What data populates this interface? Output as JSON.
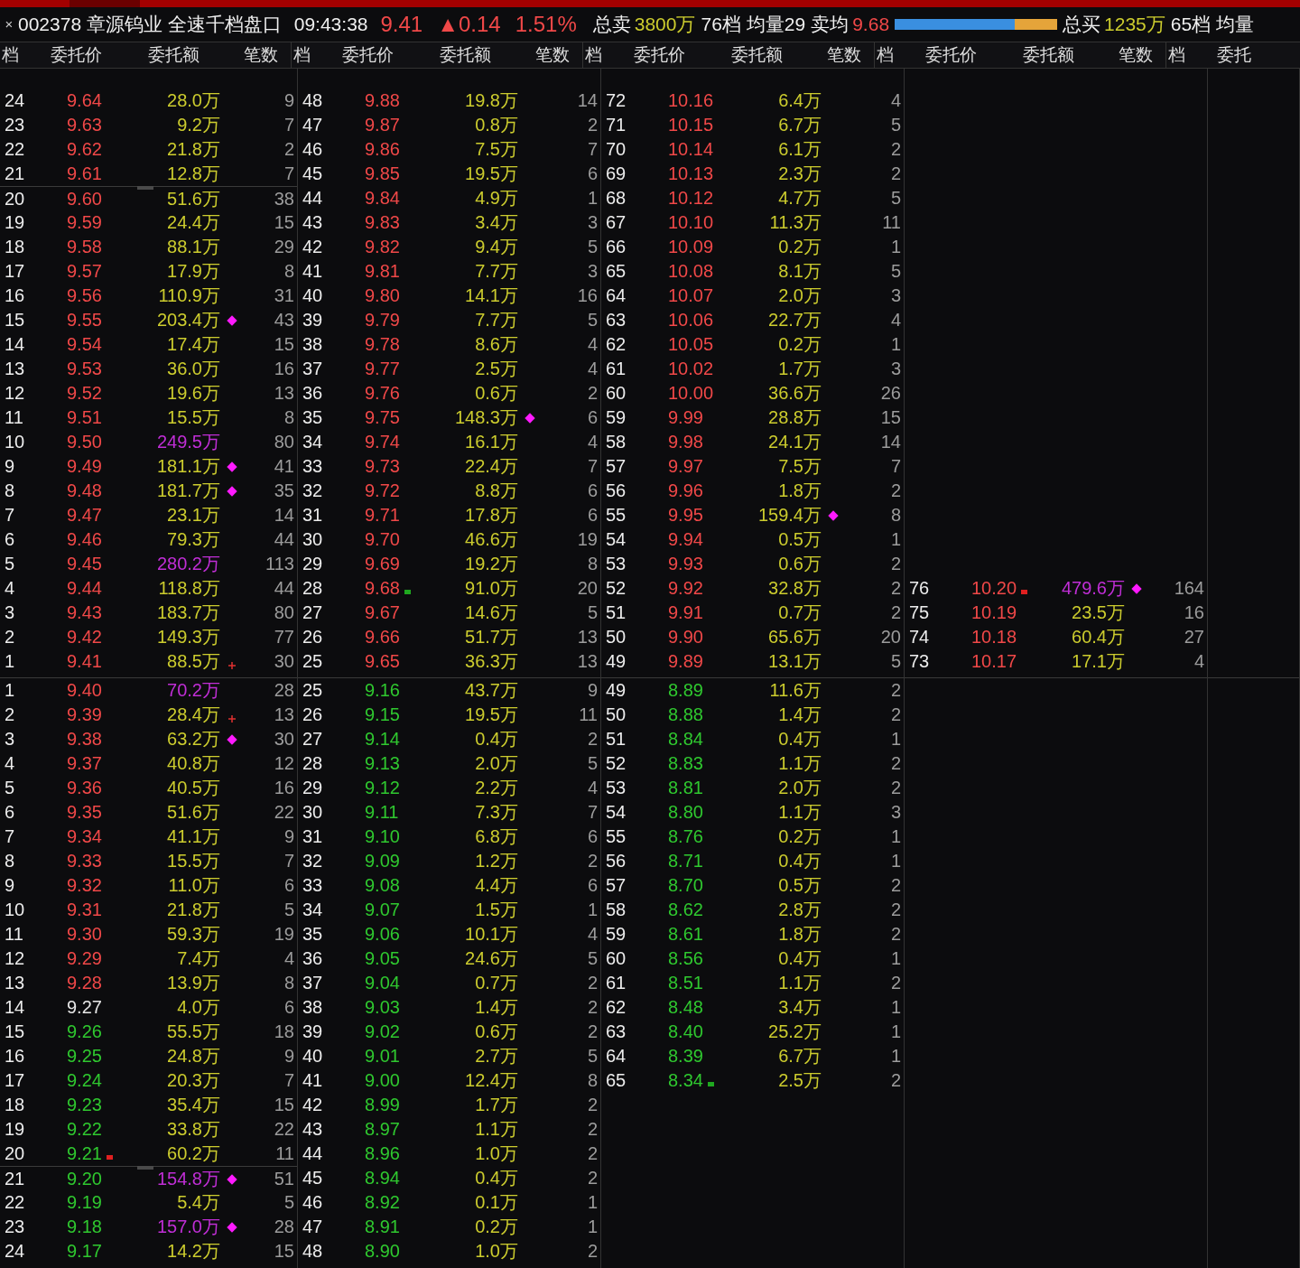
{
  "title": {
    "close": "×",
    "name": "002378 章源钨业 全速千档盘口",
    "time": "09:43:38",
    "price": "9.41",
    "change": "▲0.14",
    "percent": "1.51%",
    "sell_label": "总卖",
    "sell_total": "3800万",
    "sell_levels": "76档",
    "sell_avg_volume": "均量29",
    "sell_avg_label": "卖均",
    "sell_avg_price": "9.68",
    "ratio_bar": {
      "level": 0.74
    },
    "buy_label": "总买",
    "buy_total": "1235万",
    "buy_levels": "65档",
    "buy_avg_volume": "均量"
  },
  "columns": [
    {
      "headers": [
        "档",
        "委托价",
        "委托额",
        "笔数"
      ]
    },
    {
      "headers": [
        "档",
        "委托价",
        "委托额",
        "笔数"
      ]
    },
    {
      "headers": [
        "档",
        "委托价",
        "委托额",
        "笔数"
      ]
    },
    {
      "headers": [
        "档",
        "委托价",
        "委托额",
        "笔数"
      ]
    },
    {
      "headers": [
        "档",
        "委托"
      ]
    }
  ],
  "sell_columns": [
    {
      "rows": [
        {
          "level": "24",
          "price": "9.64",
          "amount": "28.0万",
          "count": "9",
          "color": "#f04848",
          "big": false
        },
        {
          "level": "23",
          "price": "9.63",
          "amount": "9.2万",
          "count": "7",
          "color": "#f04848",
          "big": false
        },
        {
          "level": "22",
          "price": "9.62",
          "amount": "21.8万",
          "count": "2",
          "color": "#f04848",
          "big": false
        },
        {
          "level": "21",
          "price": "9.61",
          "amount": "12.8万",
          "count": "7",
          "color": "#f04848",
          "big": false
        },
        {
          "level": "20",
          "price": "9.60",
          "amount": "51.6万",
          "count": "38",
          "color": "#f04848",
          "big": false,
          "separator": true
        },
        {
          "level": "19",
          "price": "9.59",
          "amount": "24.4万",
          "count": "15",
          "color": "#f04848",
          "big": false
        },
        {
          "level": "18",
          "price": "9.58",
          "amount": "88.1万",
          "count": "29",
          "color": "#f04848",
          "big": false
        },
        {
          "level": "17",
          "price": "9.57",
          "amount": "17.9万",
          "count": "8",
          "color": "#f04848",
          "big": false
        },
        {
          "level": "16",
          "price": "9.56",
          "amount": "110.9万",
          "count": "31",
          "color": "#f04848",
          "big": false
        },
        {
          "level": "15",
          "price": "9.55",
          "amount": "203.4万",
          "count": "43",
          "color": "#f04848",
          "big": false,
          "diamond": true
        },
        {
          "level": "14",
          "price": "9.54",
          "amount": "17.4万",
          "count": "15",
          "color": "#f04848",
          "big": false
        },
        {
          "level": "13",
          "price": "9.53",
          "amount": "36.0万",
          "count": "16",
          "color": "#f04848",
          "big": false
        },
        {
          "level": "12",
          "price": "9.52",
          "amount": "19.6万",
          "count": "13",
          "color": "#f04848",
          "big": false
        },
        {
          "level": "11",
          "price": "9.51",
          "amount": "15.5万",
          "count": "8",
          "color": "#f04848",
          "big": false
        },
        {
          "level": "10",
          "price": "9.50",
          "amount": "249.5万",
          "count": "80",
          "color": "#f04848",
          "big": true
        },
        {
          "level": "9",
          "price": "9.49",
          "amount": "181.1万",
          "count": "41",
          "color": "#f04848",
          "big": false,
          "diamond": true
        },
        {
          "level": "8",
          "price": "9.48",
          "amount": "181.7万",
          "count": "35",
          "color": "#f04848",
          "big": false,
          "diamond": true
        },
        {
          "level": "7",
          "price": "9.47",
          "amount": "23.1万",
          "count": "14",
          "color": "#f04848",
          "big": false
        },
        {
          "level": "6",
          "price": "9.46",
          "amount": "79.3万",
          "count": "44",
          "color": "#f04848",
          "big": false
        },
        {
          "level": "5",
          "price": "9.45",
          "amount": "280.2万",
          "count": "113",
          "color": "#f04848",
          "big": true
        },
        {
          "level": "4",
          "price": "9.44",
          "amount": "118.8万",
          "count": "44",
          "color": "#f04848",
          "big": false
        },
        {
          "level": "3",
          "price": "9.43",
          "amount": "183.7万",
          "count": "80",
          "color": "#f04848",
          "big": false
        },
        {
          "level": "2",
          "price": "9.42",
          "amount": "149.3万",
          "count": "77",
          "color": "#f04848",
          "big": false
        },
        {
          "level": "1",
          "price": "9.41",
          "amount": "88.5万",
          "count": "30",
          "color": "#f04848",
          "big": false,
          "plus": true
        }
      ]
    },
    {
      "rows": [
        {
          "level": "48",
          "price": "9.88",
          "amount": "19.8万",
          "count": "14",
          "color": "#f04848",
          "big": false
        },
        {
          "level": "47",
          "price": "9.87",
          "amount": "0.8万",
          "count": "2",
          "color": "#f04848",
          "big": false
        },
        {
          "level": "46",
          "price": "9.86",
          "amount": "7.5万",
          "count": "7",
          "color": "#f04848",
          "big": false
        },
        {
          "level": "45",
          "price": "9.85",
          "amount": "19.5万",
          "count": "6",
          "color": "#f04848",
          "big": false
        },
        {
          "level": "44",
          "price": "9.84",
          "amount": "4.9万",
          "count": "1",
          "color": "#f04848",
          "big": false
        },
        {
          "level": "43",
          "price": "9.83",
          "amount": "3.4万",
          "count": "3",
          "color": "#f04848",
          "big": false
        },
        {
          "level": "42",
          "price": "9.82",
          "amount": "9.4万",
          "count": "5",
          "color": "#f04848",
          "big": false
        },
        {
          "level": "41",
          "price": "9.81",
          "amount": "7.7万",
          "count": "3",
          "color": "#f04848",
          "big": false
        },
        {
          "level": "40",
          "price": "9.80",
          "amount": "14.1万",
          "count": "16",
          "color": "#f04848",
          "big": false
        },
        {
          "level": "39",
          "price": "9.79",
          "amount": "7.7万",
          "count": "5",
          "color": "#f04848",
          "big": false
        },
        {
          "level": "38",
          "price": "9.78",
          "amount": "8.6万",
          "count": "4",
          "color": "#f04848",
          "big": false
        },
        {
          "level": "37",
          "price": "9.77",
          "amount": "2.5万",
          "count": "4",
          "color": "#f04848",
          "big": false
        },
        {
          "level": "36",
          "price": "9.76",
          "amount": "0.6万",
          "count": "2",
          "color": "#f04848",
          "big": false
        },
        {
          "level": "35",
          "price": "9.75",
          "amount": "148.3万",
          "count": "6",
          "color": "#f04848",
          "big": false,
          "diamond": true
        },
        {
          "level": "34",
          "price": "9.74",
          "amount": "16.1万",
          "count": "4",
          "color": "#f04848",
          "big": false
        },
        {
          "level": "33",
          "price": "9.73",
          "amount": "22.4万",
          "count": "7",
          "color": "#f04848",
          "big": false
        },
        {
          "level": "32",
          "price": "9.72",
          "amount": "8.8万",
          "count": "6",
          "color": "#f04848",
          "big": false
        },
        {
          "level": "31",
          "price": "9.71",
          "amount": "17.8万",
          "count": "6",
          "color": "#f04848",
          "big": false
        },
        {
          "level": "30",
          "price": "9.70",
          "amount": "46.6万",
          "count": "19",
          "color": "#f04848",
          "big": false
        },
        {
          "level": "29",
          "price": "9.69",
          "amount": "19.2万",
          "count": "8",
          "color": "#f04848",
          "big": false
        },
        {
          "level": "28",
          "price": "9.68",
          "amount": "91.0万",
          "count": "20",
          "color": "#f04848",
          "big": false,
          "flag": {
            "color": "#1fa81f"
          }
        },
        {
          "level": "27",
          "price": "9.67",
          "amount": "14.6万",
          "count": "5",
          "color": "#f04848",
          "big": false
        },
        {
          "level": "26",
          "price": "9.66",
          "amount": "51.7万",
          "count": "13",
          "color": "#f04848",
          "big": false
        },
        {
          "level": "25",
          "price": "9.65",
          "amount": "36.3万",
          "count": "13",
          "color": "#f04848",
          "big": false
        }
      ]
    },
    {
      "rows": [
        {
          "level": "72",
          "price": "10.16",
          "amount": "6.4万",
          "count": "4",
          "color": "#f04848",
          "big": false
        },
        {
          "level": "71",
          "price": "10.15",
          "amount": "6.7万",
          "count": "5",
          "color": "#f04848",
          "big": false
        },
        {
          "level": "70",
          "price": "10.14",
          "amount": "6.1万",
          "count": "2",
          "color": "#f04848",
          "big": false
        },
        {
          "level": "69",
          "price": "10.13",
          "amount": "2.3万",
          "count": "2",
          "color": "#f04848",
          "big": false
        },
        {
          "level": "68",
          "price": "10.12",
          "amount": "4.7万",
          "count": "5",
          "color": "#f04848",
          "big": false
        },
        {
          "level": "67",
          "price": "10.10",
          "amount": "11.3万",
          "count": "11",
          "color": "#f04848",
          "big": false
        },
        {
          "level": "66",
          "price": "10.09",
          "amount": "0.2万",
          "count": "1",
          "color": "#f04848",
          "big": false
        },
        {
          "level": "65",
          "price": "10.08",
          "amount": "8.1万",
          "count": "5",
          "color": "#f04848",
          "big": false
        },
        {
          "level": "64",
          "price": "10.07",
          "amount": "2.0万",
          "count": "3",
          "color": "#f04848",
          "big": false
        },
        {
          "level": "63",
          "price": "10.06",
          "amount": "22.7万",
          "count": "4",
          "color": "#f04848",
          "big": false
        },
        {
          "level": "62",
          "price": "10.05",
          "amount": "0.2万",
          "count": "1",
          "color": "#f04848",
          "big": false
        },
        {
          "level": "61",
          "price": "10.02",
          "amount": "1.7万",
          "count": "3",
          "color": "#f04848",
          "big": false
        },
        {
          "level": "60",
          "price": "10.00",
          "amount": "36.6万",
          "count": "26",
          "color": "#f04848",
          "big": false
        },
        {
          "level": "59",
          "price": "9.99",
          "amount": "28.8万",
          "count": "15",
          "color": "#f04848",
          "big": false
        },
        {
          "level": "58",
          "price": "9.98",
          "amount": "24.1万",
          "count": "14",
          "color": "#f04848",
          "big": false
        },
        {
          "level": "57",
          "price": "9.97",
          "amount": "7.5万",
          "count": "7",
          "color": "#f04848",
          "big": false
        },
        {
          "level": "56",
          "price": "9.96",
          "amount": "1.8万",
          "count": "2",
          "color": "#f04848",
          "big": false
        },
        {
          "level": "55",
          "price": "9.95",
          "amount": "159.4万",
          "count": "8",
          "color": "#f04848",
          "big": false,
          "diamond": true
        },
        {
          "level": "54",
          "price": "9.94",
          "amount": "0.5万",
          "count": "1",
          "color": "#f04848",
          "big": false
        },
        {
          "level": "53",
          "price": "9.93",
          "amount": "0.6万",
          "count": "2",
          "color": "#f04848",
          "big": false
        },
        {
          "level": "52",
          "price": "9.92",
          "amount": "32.8万",
          "count": "2",
          "color": "#f04848",
          "big": false
        },
        {
          "level": "51",
          "price": "9.91",
          "amount": "0.7万",
          "count": "2",
          "color": "#f04848",
          "big": false
        },
        {
          "level": "50",
          "price": "9.90",
          "amount": "65.6万",
          "count": "20",
          "color": "#f04848",
          "big": false
        },
        {
          "level": "49",
          "price": "9.89",
          "amount": "13.1万",
          "count": "5",
          "color": "#f04848",
          "big": false
        }
      ]
    },
    {
      "rows": [
        {
          "level": "76",
          "price": "10.20",
          "amount": "479.6万",
          "count": "164",
          "color": "#f04848",
          "big": true,
          "diamond": true,
          "flag": {
            "color": "#e02020"
          }
        },
        {
          "level": "75",
          "price": "10.19",
          "amount": "23.5万",
          "count": "16",
          "color": "#f04848",
          "big": false
        },
        {
          "level": "74",
          "price": "10.18",
          "amount": "60.4万",
          "count": "27",
          "color": "#f04848",
          "big": false
        },
        {
          "level": "73",
          "price": "10.17",
          "amount": "17.1万",
          "count": "4",
          "color": "#f04848",
          "big": false
        }
      ]
    }
  ],
  "buy_columns": [
    {
      "rows": [
        {
          "level": "1",
          "price": "9.40",
          "amount": "70.2万",
          "count": "28",
          "color": "#f04848",
          "big": true
        },
        {
          "level": "2",
          "price": "9.39",
          "amount": "28.4万",
          "count": "13",
          "color": "#f04848",
          "big": false,
          "plus": true
        },
        {
          "level": "3",
          "price": "9.38",
          "amount": "63.2万",
          "count": "30",
          "color": "#f04848",
          "big": false,
          "diamond": true
        },
        {
          "level": "4",
          "price": "9.37",
          "amount": "40.8万",
          "count": "12",
          "color": "#f04848",
          "big": false
        },
        {
          "level": "5",
          "price": "9.36",
          "amount": "40.5万",
          "count": "16",
          "color": "#f04848",
          "big": false
        },
        {
          "level": "6",
          "price": "9.35",
          "amount": "51.6万",
          "count": "22",
          "color": "#f04848",
          "big": false
        },
        {
          "level": "7",
          "price": "9.34",
          "amount": "41.1万",
          "count": "9",
          "color": "#f04848",
          "big": false
        },
        {
          "level": "8",
          "price": "9.33",
          "amount": "15.5万",
          "count": "7",
          "color": "#f04848",
          "big": false
        },
        {
          "level": "9",
          "price": "9.32",
          "amount": "11.0万",
          "count": "6",
          "color": "#f04848",
          "big": false
        },
        {
          "level": "10",
          "price": "9.31",
          "amount": "21.8万",
          "count": "5",
          "color": "#f04848",
          "big": false
        },
        {
          "level": "11",
          "price": "9.30",
          "amount": "59.3万",
          "count": "19",
          "color": "#f04848",
          "big": false
        },
        {
          "level": "12",
          "price": "9.29",
          "amount": "7.4万",
          "count": "4",
          "color": "#f04848",
          "big": false
        },
        {
          "level": "13",
          "price": "9.28",
          "amount": "13.9万",
          "count": "8",
          "color": "#f04848",
          "big": false
        },
        {
          "level": "14",
          "price": "9.27",
          "amount": "4.0万",
          "count": "6",
          "color": "#e6e6e6",
          "big": false
        },
        {
          "level": "15",
          "price": "9.26",
          "amount": "55.5万",
          "count": "18",
          "color": "#2fc82f",
          "big": false
        },
        {
          "level": "16",
          "price": "9.25",
          "amount": "24.8万",
          "count": "9",
          "color": "#2fc82f",
          "big": false
        },
        {
          "level": "17",
          "price": "9.24",
          "amount": "20.3万",
          "count": "7",
          "color": "#2fc82f",
          "big": false
        },
        {
          "level": "18",
          "price": "9.23",
          "amount": "35.4万",
          "count": "15",
          "color": "#2fc82f",
          "big": false
        },
        {
          "level": "19",
          "price": "9.22",
          "amount": "33.8万",
          "count": "22",
          "color": "#2fc82f",
          "big": false
        },
        {
          "level": "20",
          "price": "9.21",
          "amount": "60.2万",
          "count": "11",
          "color": "#2fc82f",
          "big": false,
          "flag": {
            "color": "#e02020"
          }
        },
        {
          "level": "21",
          "price": "9.20",
          "amount": "154.8万",
          "count": "51",
          "color": "#2fc82f",
          "big": true,
          "diamond": true,
          "separator": true
        },
        {
          "level": "22",
          "price": "9.19",
          "amount": "5.4万",
          "count": "5",
          "color": "#2fc82f",
          "big": false
        },
        {
          "level": "23",
          "price": "9.18",
          "amount": "157.0万",
          "count": "28",
          "color": "#2fc82f",
          "big": true,
          "diamond": true
        },
        {
          "level": "24",
          "price": "9.17",
          "amount": "14.2万",
          "count": "15",
          "color": "#2fc82f",
          "big": false
        }
      ]
    },
    {
      "rows": [
        {
          "level": "25",
          "price": "9.16",
          "amount": "43.7万",
          "count": "9",
          "color": "#2fc82f",
          "big": false
        },
        {
          "level": "26",
          "price": "9.15",
          "amount": "19.5万",
          "count": "11",
          "color": "#2fc82f",
          "big": false
        },
        {
          "level": "27",
          "price": "9.14",
          "amount": "0.4万",
          "count": "2",
          "color": "#2fc82f",
          "big": false
        },
        {
          "level": "28",
          "price": "9.13",
          "amount": "2.0万",
          "count": "5",
          "color": "#2fc82f",
          "big": false
        },
        {
          "level": "29",
          "price": "9.12",
          "amount": "2.2万",
          "count": "4",
          "color": "#2fc82f",
          "big": false
        },
        {
          "level": "30",
          "price": "9.11",
          "amount": "7.3万",
          "count": "7",
          "color": "#2fc82f",
          "big": false
        },
        {
          "level": "31",
          "price": "9.10",
          "amount": "6.8万",
          "count": "6",
          "color": "#2fc82f",
          "big": false
        },
        {
          "level": "32",
          "price": "9.09",
          "amount": "1.2万",
          "count": "2",
          "color": "#2fc82f",
          "big": false
        },
        {
          "level": "33",
          "price": "9.08",
          "amount": "4.4万",
          "count": "6",
          "color": "#2fc82f",
          "big": false
        },
        {
          "level": "34",
          "price": "9.07",
          "amount": "1.5万",
          "count": "1",
          "color": "#2fc82f",
          "big": false
        },
        {
          "level": "35",
          "price": "9.06",
          "amount": "10.1万",
          "count": "4",
          "color": "#2fc82f",
          "big": false
        },
        {
          "level": "36",
          "price": "9.05",
          "amount": "24.6万",
          "count": "5",
          "color": "#2fc82f",
          "big": false
        },
        {
          "level": "37",
          "price": "9.04",
          "amount": "0.7万",
          "count": "2",
          "color": "#2fc82f",
          "big": false
        },
        {
          "level": "38",
          "price": "9.03",
          "amount": "1.4万",
          "count": "2",
          "color": "#2fc82f",
          "big": false
        },
        {
          "level": "39",
          "price": "9.02",
          "amount": "0.6万",
          "count": "2",
          "color": "#2fc82f",
          "big": false
        },
        {
          "level": "40",
          "price": "9.01",
          "amount": "2.7万",
          "count": "5",
          "color": "#2fc82f",
          "big": false
        },
        {
          "level": "41",
          "price": "9.00",
          "amount": "12.4万",
          "count": "8",
          "color": "#2fc82f",
          "big": false
        },
        {
          "level": "42",
          "price": "8.99",
          "amount": "1.7万",
          "count": "2",
          "color": "#2fc82f",
          "big": false
        },
        {
          "level": "43",
          "price": "8.97",
          "amount": "1.1万",
          "count": "2",
          "color": "#2fc82f",
          "big": false
        },
        {
          "level": "44",
          "price": "8.96",
          "amount": "1.0万",
          "count": "2",
          "color": "#2fc82f",
          "big": false
        },
        {
          "level": "45",
          "price": "8.94",
          "amount": "0.4万",
          "count": "2",
          "color": "#2fc82f",
          "big": false
        },
        {
          "level": "46",
          "price": "8.92",
          "amount": "0.1万",
          "count": "1",
          "color": "#2fc82f",
          "big": false
        },
        {
          "level": "47",
          "price": "8.91",
          "amount": "0.2万",
          "count": "1",
          "color": "#2fc82f",
          "big": false
        },
        {
          "level": "48",
          "price": "8.90",
          "amount": "1.0万",
          "count": "2",
          "color": "#2fc82f",
          "big": false
        }
      ]
    },
    {
      "rows": [
        {
          "level": "49",
          "price": "8.89",
          "amount": "11.6万",
          "count": "2",
          "color": "#2fc82f",
          "big": false
        },
        {
          "level": "50",
          "price": "8.88",
          "amount": "1.4万",
          "count": "2",
          "color": "#2fc82f",
          "big": false
        },
        {
          "level": "51",
          "price": "8.84",
          "amount": "0.4万",
          "count": "1",
          "color": "#2fc82f",
          "big": false
        },
        {
          "level": "52",
          "price": "8.83",
          "amount": "1.1万",
          "count": "2",
          "color": "#2fc82f",
          "big": false
        },
        {
          "level": "53",
          "price": "8.81",
          "amount": "2.0万",
          "count": "2",
          "color": "#2fc82f",
          "big": false
        },
        {
          "level": "54",
          "price": "8.80",
          "amount": "1.1万",
          "count": "3",
          "color": "#2fc82f",
          "big": false
        },
        {
          "level": "55",
          "price": "8.76",
          "amount": "0.2万",
          "count": "1",
          "color": "#2fc82f",
          "big": false
        },
        {
          "level": "56",
          "price": "8.71",
          "amount": "0.4万",
          "count": "1",
          "color": "#2fc82f",
          "big": false
        },
        {
          "level": "57",
          "price": "8.70",
          "amount": "0.5万",
          "count": "2",
          "color": "#2fc82f",
          "big": false
        },
        {
          "level": "58",
          "price": "8.62",
          "amount": "2.8万",
          "count": "2",
          "color": "#2fc82f",
          "big": false
        },
        {
          "level": "59",
          "price": "8.61",
          "amount": "1.8万",
          "count": "2",
          "color": "#2fc82f",
          "big": false
        },
        {
          "level": "60",
          "price": "8.56",
          "amount": "0.4万",
          "count": "1",
          "color": "#2fc82f",
          "big": false
        },
        {
          "level": "61",
          "price": "8.51",
          "amount": "1.1万",
          "count": "2",
          "color": "#2fc82f",
          "big": false
        },
        {
          "level": "62",
          "price": "8.48",
          "amount": "3.4万",
          "count": "1",
          "color": "#2fc82f",
          "big": false
        },
        {
          "level": "63",
          "price": "8.40",
          "amount": "25.2万",
          "count": "1",
          "color": "#2fc82f",
          "big": false
        },
        {
          "level": "64",
          "price": "8.39",
          "amount": "6.7万",
          "count": "1",
          "color": "#2fc82f",
          "big": false
        },
        {
          "level": "65",
          "price": "8.34",
          "amount": "2.5万",
          "count": "2",
          "color": "#2fc82f",
          "big": false,
          "flag": {
            "color": "#1fa81f"
          }
        }
      ]
    }
  ]
}
